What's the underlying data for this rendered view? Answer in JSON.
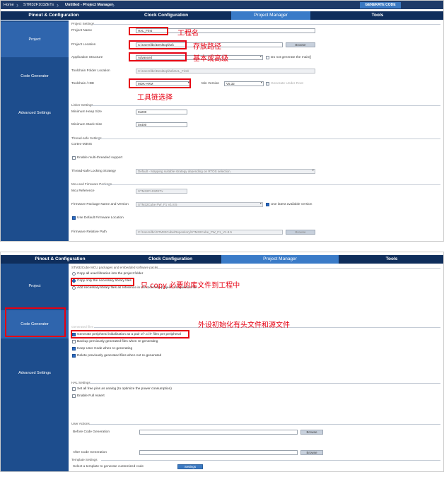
{
  "top": {
    "breadcrumbs": [
      "Home",
      "STM32F103ZETx",
      "Untitled - Project Manager"
    ],
    "generate_label": "GENERATE CODE",
    "tabs": [
      "Pinout & Configuration",
      "Clock Configuration",
      "Project Manager",
      "Tools"
    ],
    "sidebar": [
      "Project",
      "Code Generator",
      "Advanced Settings"
    ],
    "project_settings": {
      "title": "Project Settings",
      "name_label": "Project Name",
      "name_value": "HAL_First",
      "location_label": "Project Location",
      "location_value": "C:\\Users\\lbc\\Desktop\\hal\\",
      "browse": "Browse",
      "structure_label": "Application Structure",
      "structure_value": "Advanced",
      "no_main_label": "Do not generate the main()",
      "toolchain_folder_label": "Toolchain Folder Location",
      "toolchain_folder_value": "C:\\Users\\lbc\\Desktop\\hal\\HAL_First\\",
      "toolchain_label": "Toolchain / IDE",
      "toolchain_value": "MDK-ARM",
      "min_version_label": "Min Version",
      "min_version_value": "V5.32",
      "gen_under_root_label": "Generate Under Root"
    },
    "linker": {
      "title": "Linker Settings",
      "heap_label": "Minimum Heap Size",
      "heap_value": "0x200",
      "stack_label": "Minimum Stack Size",
      "stack_value": "0x400"
    },
    "thread": {
      "title": "Thread-safe Settings",
      "sub": "Cortex-M3NS",
      "enable_label": "Enable multi-threaded support",
      "strategy_label": "Thread-safe Locking Strategy",
      "strategy_value": "Default  -  Mapping suitable strategy depending on RTOS selection."
    },
    "mcu": {
      "title": "Mcu and Firmware Package",
      "ref_label": "Mcu Reference",
      "ref_value": "STM32F103ZETx",
      "pkg_label": "Firmware Package Name and Version",
      "pkg_value": "STM32Cube FW_F1 V1.8.5",
      "latest_label": "Use latest available version",
      "default_loc_label": "Use Default Firmware Location",
      "path_label": "Firmware Relative Path",
      "path_value": "C:/Users/lbc/STM32Cube/Repository/STM32Cube_FW_F1_V1.8.5",
      "browse": "Browse"
    },
    "annotations": {
      "name": "工程名",
      "path": "存放路径",
      "structure": "基本或高级",
      "toolchain": "工具链选择"
    }
  },
  "bottom": {
    "tabs": [
      "Pinout & Configuration",
      "Clock Configuration",
      "Project Manager",
      "Tools"
    ],
    "sidebar": [
      "Project",
      "Code Generator",
      "Advanced Settings"
    ],
    "packages": {
      "title": "STM32Cube MCU packages and embedded software packs",
      "opt1": "Copy all used libraries into the project folder",
      "opt2": "Copy only the necessary library files",
      "opt3": "Add necessary library files as reference in the toolchain project configuration file"
    },
    "generated": {
      "title": "Generated files",
      "opt1": "Generate peripheral initialization as a pair of '.c/.h' files per peripheral",
      "opt2": "Backup previously generated files when re-generating",
      "opt3": "Keep User Code when re-generating",
      "opt4": "Delete previously generated files when not re-generated"
    },
    "hal": {
      "title": "HAL Settings",
      "opt1": "Set all free pins as analog (to optimize the power consumption)",
      "opt2": "Enable Full Assert"
    },
    "user_actions": {
      "title": "User Actions",
      "before_label": "Before Code Generation",
      "after_label": "After Code Generation",
      "browse": "Browse"
    },
    "template": {
      "title": "Template Settings",
      "label": "Select a template to generate customized code",
      "button": "Settings"
    },
    "annotations": {
      "copy": "只 copy 必要的库文件到工程中",
      "periph": "外设初始化有头文件和源文件"
    }
  }
}
